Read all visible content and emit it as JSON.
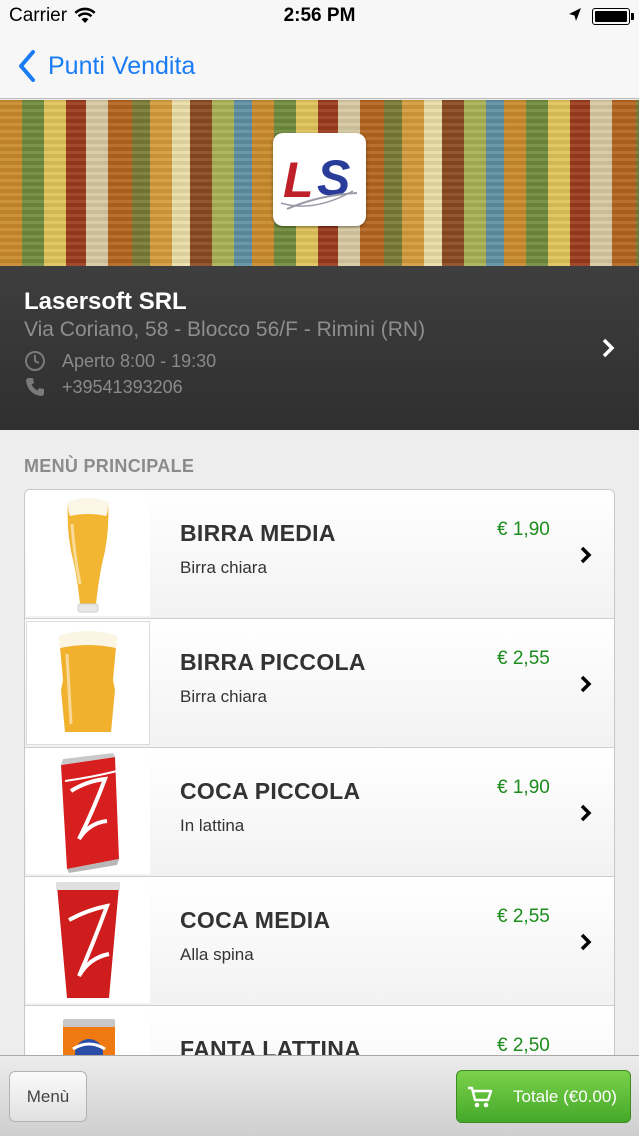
{
  "status_bar": {
    "carrier": "Carrier",
    "time": "2:56 PM",
    "icons": [
      "wifi-icon",
      "location-arrow-icon",
      "battery-icon"
    ]
  },
  "nav": {
    "back_label": "Punti Vendita",
    "accent_color": "#1a7cf5"
  },
  "banner": {
    "logo_text": "LS"
  },
  "shop": {
    "name": "Lasersoft SRL",
    "address": "Via Coriano, 58 - Blocco 56/F - Rimini (RN)",
    "hours": "Aperto 8:00 - 19:30",
    "phone": "+39541393206",
    "icons": [
      "clock-icon",
      "phone-icon",
      "chevron-right-icon"
    ]
  },
  "menu": {
    "section_title": "MENÙ PRINCIPALE",
    "price_color": "#1c8c1c",
    "items": [
      {
        "title": "BIRRA MEDIA",
        "description": "Birra chiara",
        "price": "€ 1,90",
        "image": "tall-beer-glass"
      },
      {
        "title": "BIRRA PICCOLA",
        "description": "Birra chiara",
        "price": "€ 2,55",
        "image": "pint-beer-glass"
      },
      {
        "title": "COCA PICCOLA",
        "description": "In lattina",
        "price": "€ 1,90",
        "image": "coca-cola-can"
      },
      {
        "title": "COCA MEDIA",
        "description": "Alla spina",
        "price": "€ 2,55",
        "image": "coca-cola-cup"
      },
      {
        "title": "FANTA LATTINA",
        "description": "",
        "price": "€ 2,50",
        "image": "fanta-can"
      }
    ]
  },
  "toolbar": {
    "menu_label": "Menù",
    "total_label": "Totale (€0.00)",
    "total_color": "#45a82a"
  }
}
